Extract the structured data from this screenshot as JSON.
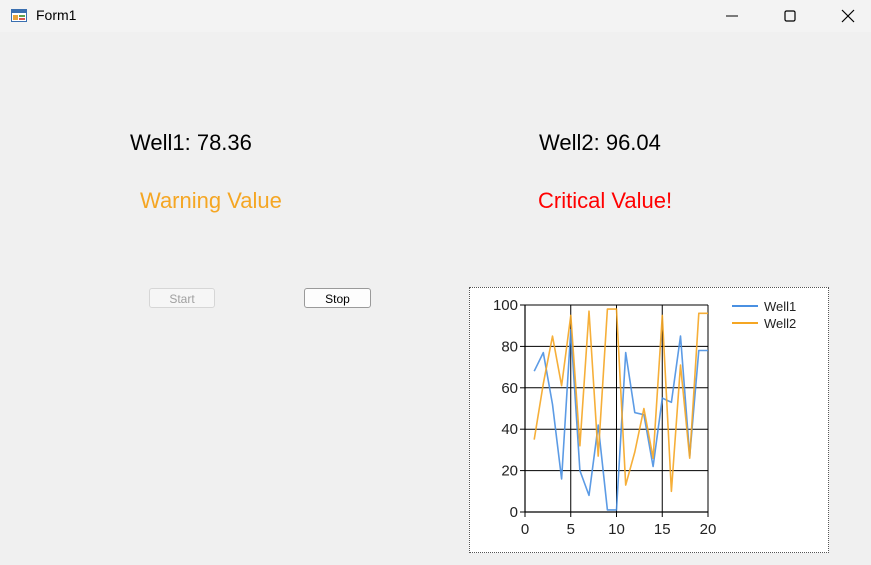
{
  "window": {
    "title": "Form1"
  },
  "well1": {
    "label": "Well1: 78.36",
    "status": "Warning Value",
    "status_color": "#f5a623"
  },
  "well2": {
    "label": "Well2: 96.04",
    "status": "Critical Value!",
    "status_color": "#ff0000"
  },
  "buttons": {
    "start_label": "Start",
    "stop_label": "Stop"
  },
  "chart_data": {
    "type": "line",
    "x": [
      1,
      2,
      3,
      4,
      5,
      6,
      7,
      8,
      9,
      10,
      11,
      12,
      13,
      14,
      15,
      16,
      17,
      18,
      19,
      20
    ],
    "xlim": [
      0,
      20
    ],
    "ylim": [
      0,
      100
    ],
    "xticks": [
      0,
      5,
      10,
      15,
      20
    ],
    "yticks": [
      0,
      20,
      40,
      60,
      80,
      100
    ],
    "grid": true,
    "legend_position": "top-right",
    "series": [
      {
        "name": "Well1",
        "color": "#4a90e2",
        "values": [
          68,
          77,
          52,
          16,
          88,
          20,
          8,
          42,
          1,
          1,
          77,
          48,
          47,
          22,
          55,
          53,
          85,
          27,
          78,
          78
        ]
      },
      {
        "name": "Well2",
        "color": "#f5a623",
        "values": [
          35,
          62,
          85,
          61,
          95,
          32,
          97,
          27,
          98,
          98,
          13,
          29,
          50,
          26,
          95,
          10,
          71,
          26,
          96,
          96
        ]
      }
    ]
  }
}
